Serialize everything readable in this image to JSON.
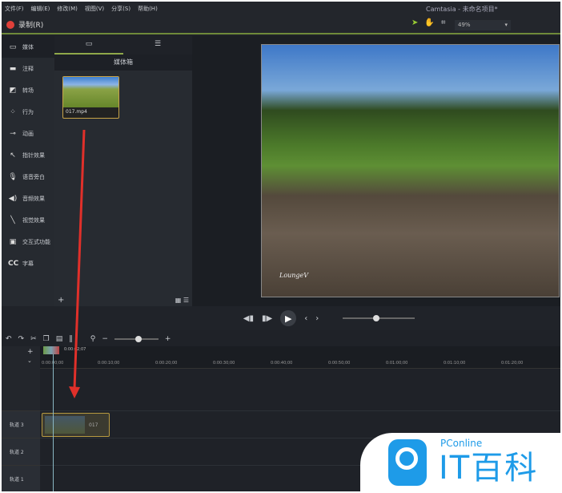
{
  "menu": [
    "文件(F)",
    "编辑(E)",
    "修改(M)",
    "视图(V)",
    "分享(S)",
    "帮助(H)"
  ],
  "window_title": "Camtasia - 未命名项目*",
  "record_label": "录制(R)",
  "zoom_level": "49%",
  "sidebar": {
    "items": [
      {
        "label": "媒体",
        "icon": "media-icon"
      },
      {
        "label": "注释",
        "icon": "annotation-icon"
      },
      {
        "label": "转场",
        "icon": "transition-icon"
      },
      {
        "label": "行为",
        "icon": "behavior-icon"
      },
      {
        "label": "动画",
        "icon": "animation-icon"
      },
      {
        "label": "指针效果",
        "icon": "cursor-icon"
      },
      {
        "label": "语音旁白",
        "icon": "mic-icon"
      },
      {
        "label": "音频效果",
        "icon": "audio-icon"
      },
      {
        "label": "视觉效果",
        "icon": "wand-icon"
      },
      {
        "label": "交互式功能",
        "icon": "interactive-icon"
      },
      {
        "label": "字幕",
        "icon": "cc-icon"
      }
    ]
  },
  "media": {
    "header": "媒体箱",
    "file": "017.mp4"
  },
  "preview": {
    "watermark": "LoungeV"
  },
  "timeline": {
    "playhead_time": "0:00:02;07",
    "ticks": [
      "0:00:00;00",
      "0:00:10;00",
      "0:00:20;00",
      "0:00:30;00",
      "0:00:40;00",
      "0:00:50;00",
      "0:01:00;00",
      "0:01:10;00",
      "0:01:20;00"
    ],
    "tracks": [
      "轨道 3",
      "轨道 2",
      "轨道 1"
    ],
    "clip_label": "017"
  },
  "logo": {
    "top": "PConline",
    "main": "IT百科"
  },
  "colors": {
    "accent": "#8fa84a",
    "record": "#e0403a",
    "arrow": "#e0302a",
    "logo": "#1e9be8"
  }
}
